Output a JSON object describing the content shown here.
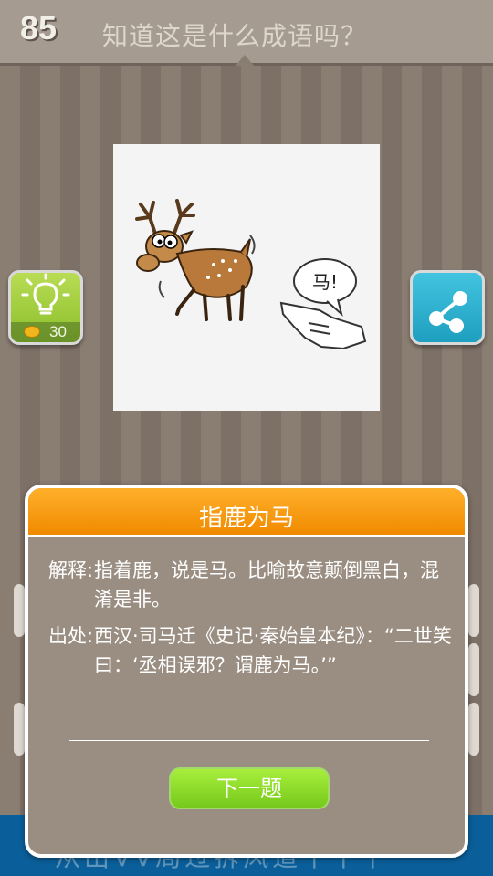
{
  "header": {
    "level": "85",
    "question": "知道这是什么成语吗？"
  },
  "hint": {
    "cost": "30",
    "icon": "lightbulb-icon",
    "coin_icon": "coin-icon"
  },
  "share": {
    "icon": "share-icon"
  },
  "picture": {
    "speech": "马!",
    "description_icon": "deer-and-pointing-hand-illustration"
  },
  "bottom_banner": {
    "text": "从出VV局过拆风道十十十"
  },
  "dialog": {
    "title": "指鹿为马",
    "explanation_label": "解释:",
    "explanation": "指着鹿，说是马。比喻故意颠倒黑白，混淆是非。",
    "source_label": "出处:",
    "source": "西汉·司马迁《史记·秦始皇本纪》：“二世笑曰：‘丞相误邪？谓鹿为马。’”",
    "next_button": "下一题"
  },
  "colors": {
    "title_bar": "#f49a0f",
    "dialog_bg": "#9a8d81",
    "next_button": "#8ed92a",
    "hint_button": "#9fcd3d",
    "share_button": "#2eb3d3",
    "bottom_bar": "#0a5f9a"
  }
}
